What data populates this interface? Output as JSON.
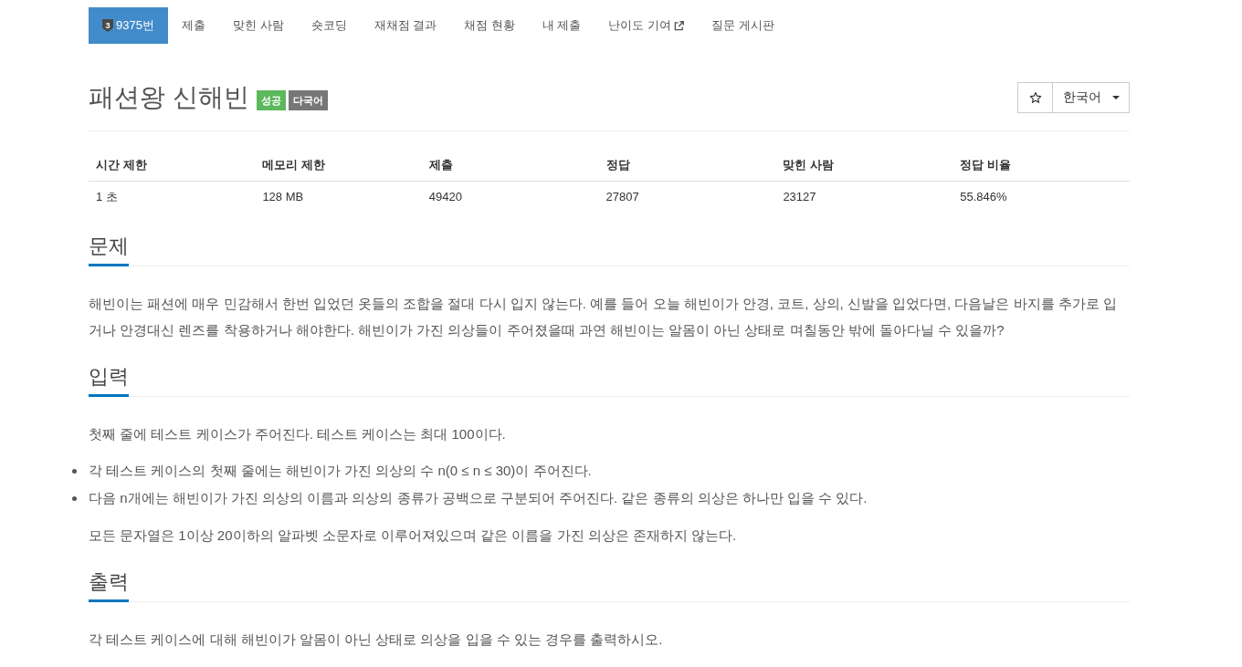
{
  "nav": {
    "items": [
      {
        "label": "9375번",
        "selected": true,
        "external": false,
        "tier": "3"
      },
      {
        "label": "제출",
        "selected": false,
        "external": false
      },
      {
        "label": "맞힌 사람",
        "selected": false,
        "external": false
      },
      {
        "label": "숏코딩",
        "selected": false,
        "external": false
      },
      {
        "label": "재채점 결과",
        "selected": false,
        "external": false
      },
      {
        "label": "채점 현황",
        "selected": false,
        "external": false
      },
      {
        "label": "내 제출",
        "selected": false,
        "external": false
      },
      {
        "label": "난이도 기여",
        "selected": false,
        "external": true
      },
      {
        "label": "질문 게시판",
        "selected": false,
        "external": false
      }
    ]
  },
  "problem": {
    "title": "패션왕 신해빈",
    "tags": [
      {
        "text": "성공",
        "kind": "success"
      },
      {
        "text": "다국어",
        "kind": "neutral"
      }
    ]
  },
  "actions": {
    "starred": false,
    "language": "한국어"
  },
  "stats": {
    "columns": [
      "시간 제한",
      "메모리 제한",
      "제출",
      "정답",
      "맞힌 사람",
      "정답 비율"
    ],
    "rows": [
      [
        "1 초",
        "128 MB",
        "49420",
        "27807",
        "23127",
        "55.846%"
      ]
    ]
  },
  "sections": [
    {
      "heading": "문제",
      "blocks": [
        {
          "kind": "paragraph",
          "text": "해빈이는 패션에 매우 민감해서 한번 입었던 옷들의 조합을 절대 다시 입지 않는다. 예를 들어 오늘 해빈이가 안경, 코트, 상의, 신발을 입었다면, 다음날은 바지를 추가로 입거나 안경대신 렌즈를 착용하거나 해야한다. 해빈이가 가진 의상들이 주어졌을때 과연 해빈이는 알몸이 아닌 상태로 며칠동안 밖에 돌아다닐 수 있을까?"
        }
      ]
    },
    {
      "heading": "입력",
      "blocks": [
        {
          "kind": "paragraph",
          "text": "첫째 줄에 테스트 케이스가 주어진다. 테스트 케이스는 최대 100이다."
        },
        {
          "kind": "list",
          "items": [
            "각 테스트 케이스의 첫째 줄에는 해빈이가 가진 의상의 수 n(0 ≤ n ≤ 30)이 주어진다.",
            "다음 n개에는 해빈이가 가진 의상의 이름과 의상의 종류가 공백으로 구분되어 주어진다. 같은 종류의 의상은 하나만 입을 수 있다."
          ]
        },
        {
          "kind": "paragraph",
          "text": "모든 문자열은 1이상 20이하의 알파벳 소문자로 이루어져있으며 같은 이름을 가진 의상은 존재하지 않는다."
        }
      ]
    },
    {
      "heading": "출력",
      "blocks": [
        {
          "kind": "paragraph",
          "text": "각 테스트 케이스에 대해 해빈이가 알몸이 아닌 상태로 의상을 입을 수 있는 경우를 출력하시오."
        }
      ]
    }
  ]
}
